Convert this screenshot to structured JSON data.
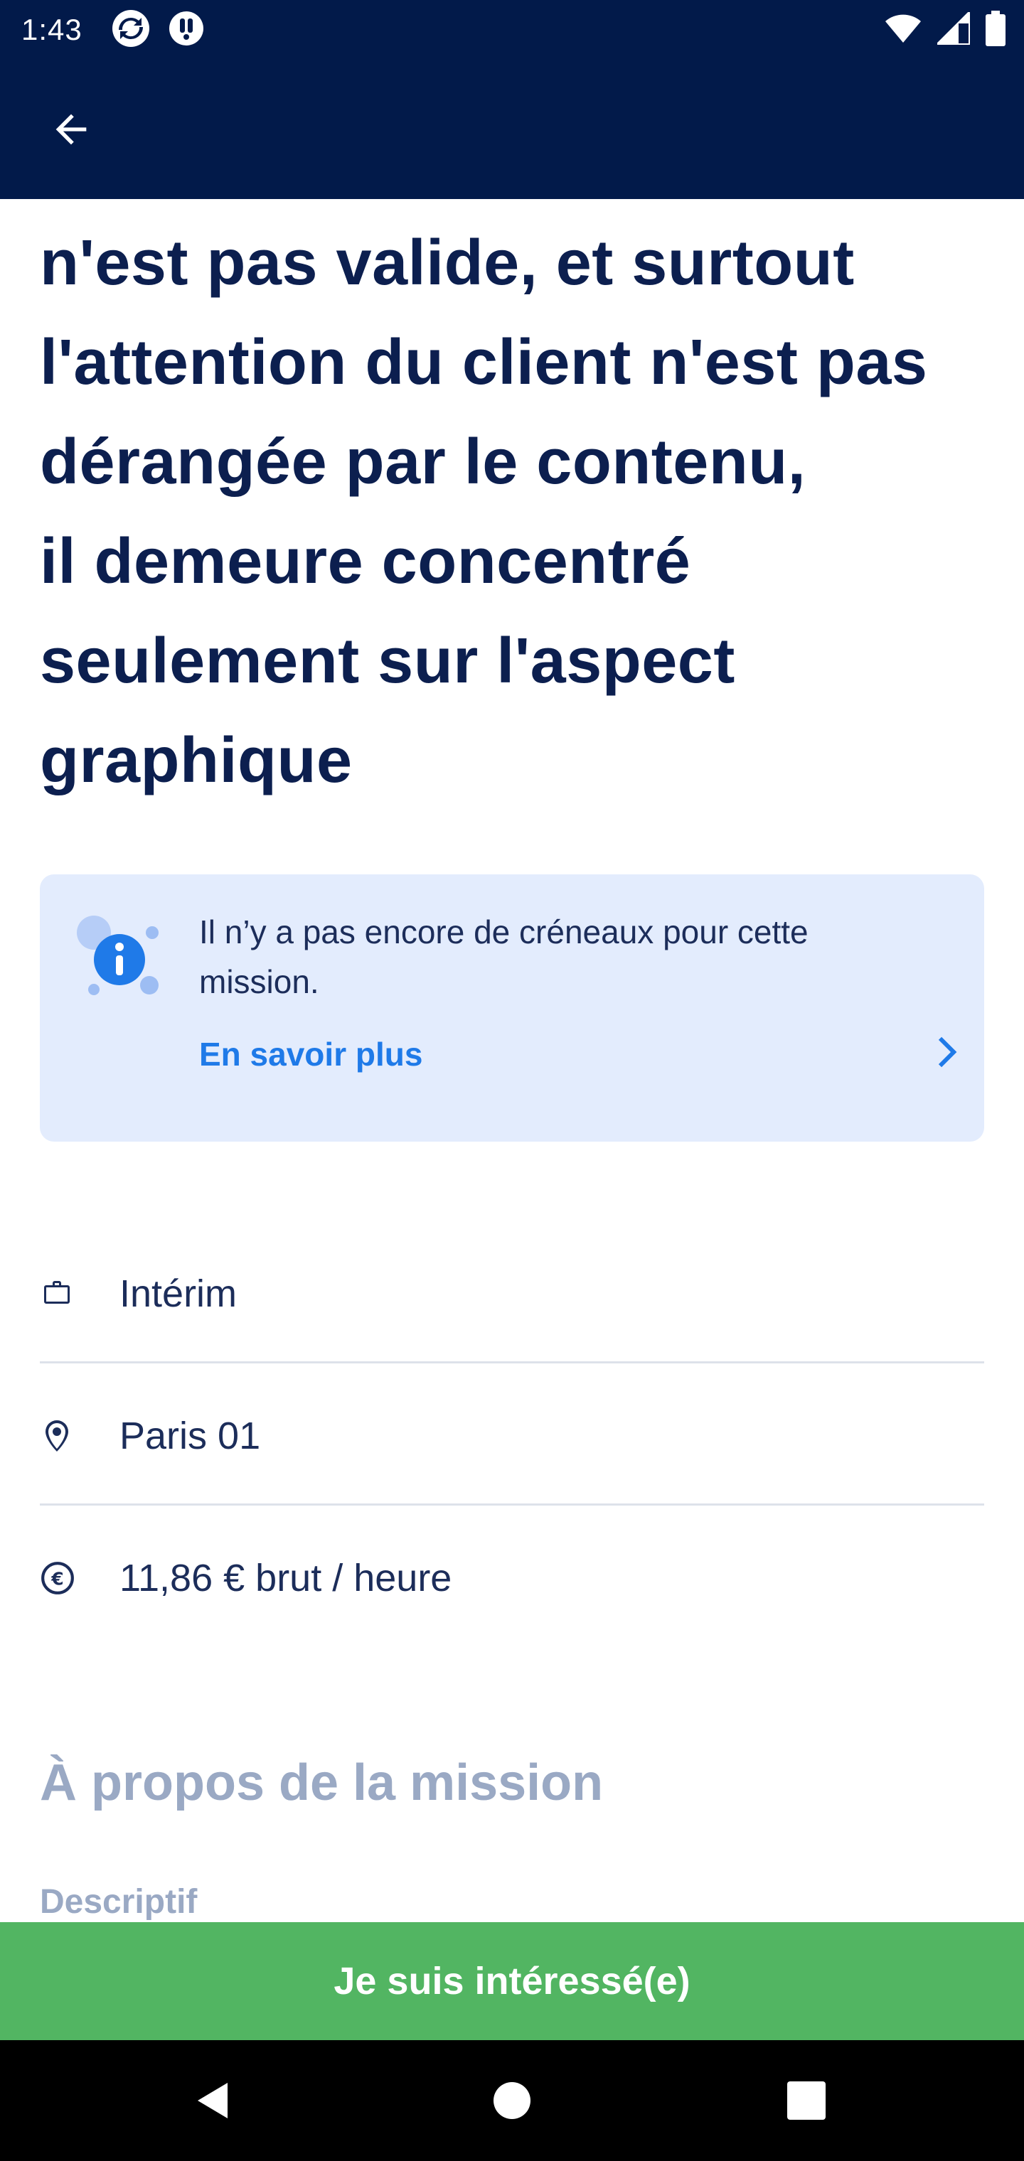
{
  "status_bar": {
    "time": "1:43",
    "app_icons": [
      "sync-app-icon",
      "notification-app-icon"
    ],
    "right_icons": [
      "wifi-icon",
      "signal-icon",
      "battery-icon"
    ]
  },
  "app_bar": {
    "back_icon": "arrow-back-icon"
  },
  "mission": {
    "title_lines": [
      "n'est pas valide, et surtout",
      "l'attention du client n'est pas",
      "dérangée par le contenu,",
      "il demeure concentré",
      "seulement sur l'aspect",
      "graphique"
    ]
  },
  "info_card": {
    "message": "Il n’y a pas encore de créneaux pour cette mission.",
    "link_label": "En savoir plus",
    "icon": "info-icon"
  },
  "details": [
    {
      "icon": "briefcase-icon",
      "text": "Intérim"
    },
    {
      "icon": "location-pin-icon",
      "text": "Paris 01"
    },
    {
      "icon": "euro-icon",
      "text": "11,86 € brut / heure"
    }
  ],
  "about": {
    "title": "À propos de la mission",
    "subtitle": "Descriptif"
  },
  "cta": {
    "label": "Je suis intéressé(e)"
  },
  "nav": {
    "icons": [
      "nav-back-icon",
      "nav-home-icon",
      "nav-recents-icon"
    ]
  },
  "colors": {
    "primary_dark": "#021a4a",
    "title_text": "#0c1f4f",
    "info_bg": "#e3ecfd",
    "link_blue": "#1f7ae8",
    "cta_green": "#52b562",
    "muted_heading": "#9aa9c4"
  }
}
